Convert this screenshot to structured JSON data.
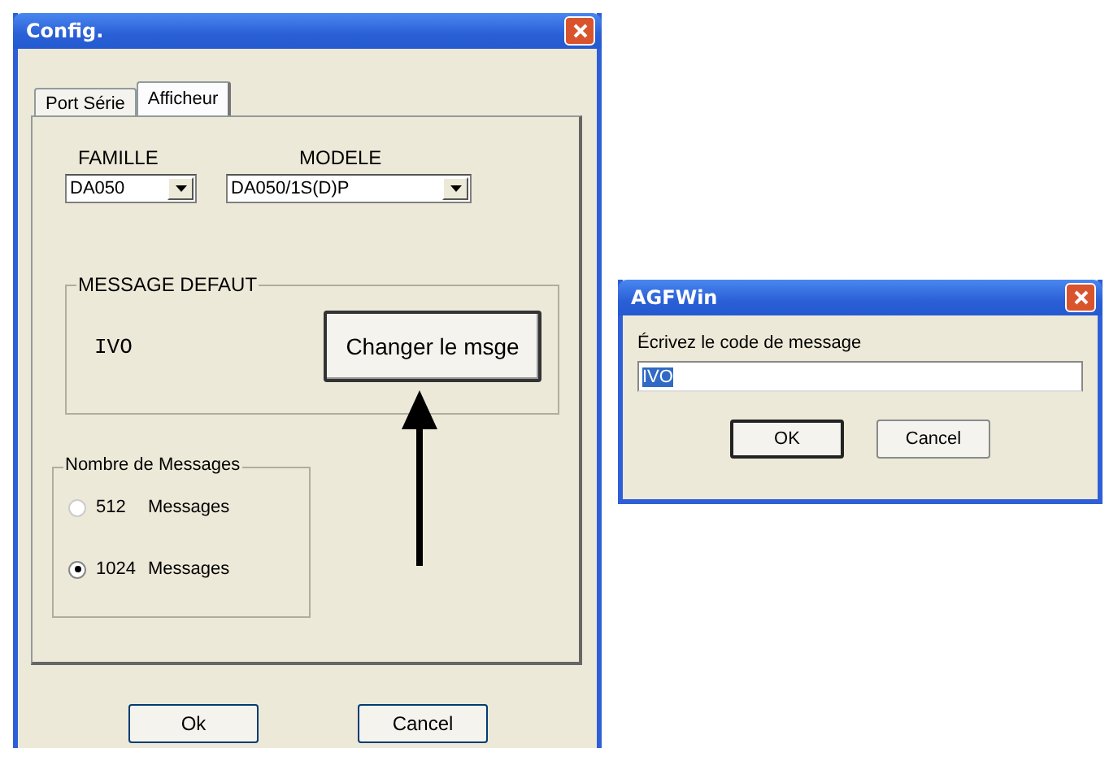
{
  "config_window": {
    "title": "Config.",
    "tabs": [
      {
        "label": "Port Série",
        "selected": false
      },
      {
        "label": "Afficheur",
        "selected": true
      }
    ],
    "famille": {
      "label": "FAMILLE",
      "value": "DA050"
    },
    "modele": {
      "label": "MODELE",
      "value": "DA050/1S(D)P"
    },
    "message_group": {
      "title": "MESSAGE DEFAUT",
      "message": "IVO",
      "button": "Changer le msge"
    },
    "count_group": {
      "title": "Nombre de Messages",
      "options": [
        {
          "value": "512",
          "unit": "Messages",
          "selected": false
        },
        {
          "value": "1024",
          "unit": "Messages",
          "selected": true
        }
      ]
    },
    "buttons": [
      "Ok",
      "Cancel"
    ]
  },
  "prompt_window": {
    "title": "AGFWin",
    "label": "Écrivez le code de message",
    "input": {
      "value": "IVO",
      "text_selected": true
    },
    "buttons": [
      "OK",
      "Cancel"
    ]
  }
}
